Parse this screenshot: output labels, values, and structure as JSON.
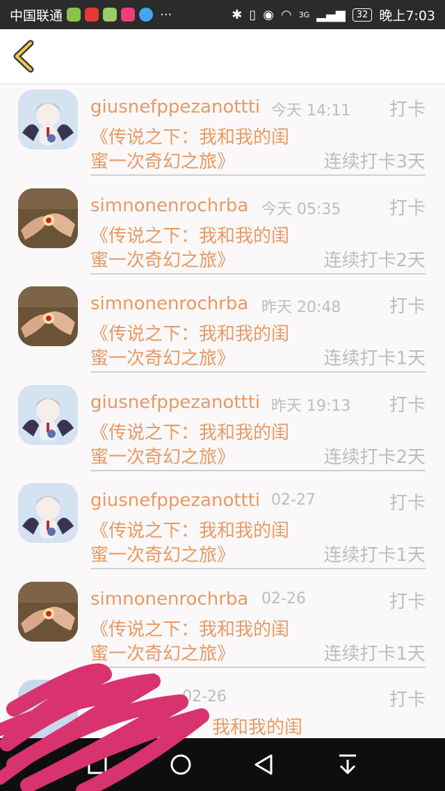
{
  "status_bar": {
    "carrier": "中国联通",
    "network": "3G",
    "battery": "32",
    "time": "晚上7:03"
  },
  "header": {
    "back_icon": "chevron-left-icon"
  },
  "feed": [
    {
      "user": "giusnefppezanottti",
      "time": "今天 14:11",
      "tag": "打卡",
      "title_line1": "《传说之下：我和我的闺",
      "title_line2": "蜜一次奇幻之旅》",
      "streak": "连续打卡3天",
      "avatar": "anime-avatar"
    },
    {
      "user": "simnonenrochrba",
      "time": "今天 05:35",
      "tag": "打卡",
      "title_line1": "《传说之下：我和我的闺",
      "title_line2": "蜜一次奇幻之旅》",
      "streak": "连续打卡2天",
      "avatar": "hands-photo-avatar"
    },
    {
      "user": "simnonenrochrba",
      "time": "昨天 20:48",
      "tag": "打卡",
      "title_line1": "《传说之下：我和我的闺",
      "title_line2": "蜜一次奇幻之旅》",
      "streak": "连续打卡1天",
      "avatar": "hands-photo-avatar"
    },
    {
      "user": "giusnefppezanottti",
      "time": "昨天 19:13",
      "tag": "打卡",
      "title_line1": "《传说之下：我和我的闺",
      "title_line2": "蜜一次奇幻之旅》",
      "streak": "连续打卡2天",
      "avatar": "anime-avatar"
    },
    {
      "user": "giusnefppezanottti",
      "time": "02-27",
      "tag": "打卡",
      "title_line1": "《传说之下：我和我的闺",
      "title_line2": "蜜一次奇幻之旅》",
      "streak": "连续打卡1天",
      "avatar": "anime-avatar"
    },
    {
      "user": "simnonenrochrba",
      "time": "02-26",
      "tag": "打卡",
      "title_line1": "《传说之下：我和我的闺",
      "title_line2": "蜜一次奇幻之旅》",
      "streak": "连续打卡1天",
      "avatar": "hands-photo-avatar"
    },
    {
      "user": "",
      "time": "02-26",
      "tag": "打卡",
      "title_line1": "我和我的闺",
      "title_line2": "",
      "streak": "",
      "avatar": "redacted-avatar"
    }
  ],
  "nav_bar": {
    "icons": [
      "recent-apps-icon",
      "home-icon",
      "back-icon",
      "notification-pull-icon"
    ]
  },
  "colors": {
    "accent": "#e89a62",
    "muted": "#bdbdbd",
    "scribble": "#d8336e"
  }
}
